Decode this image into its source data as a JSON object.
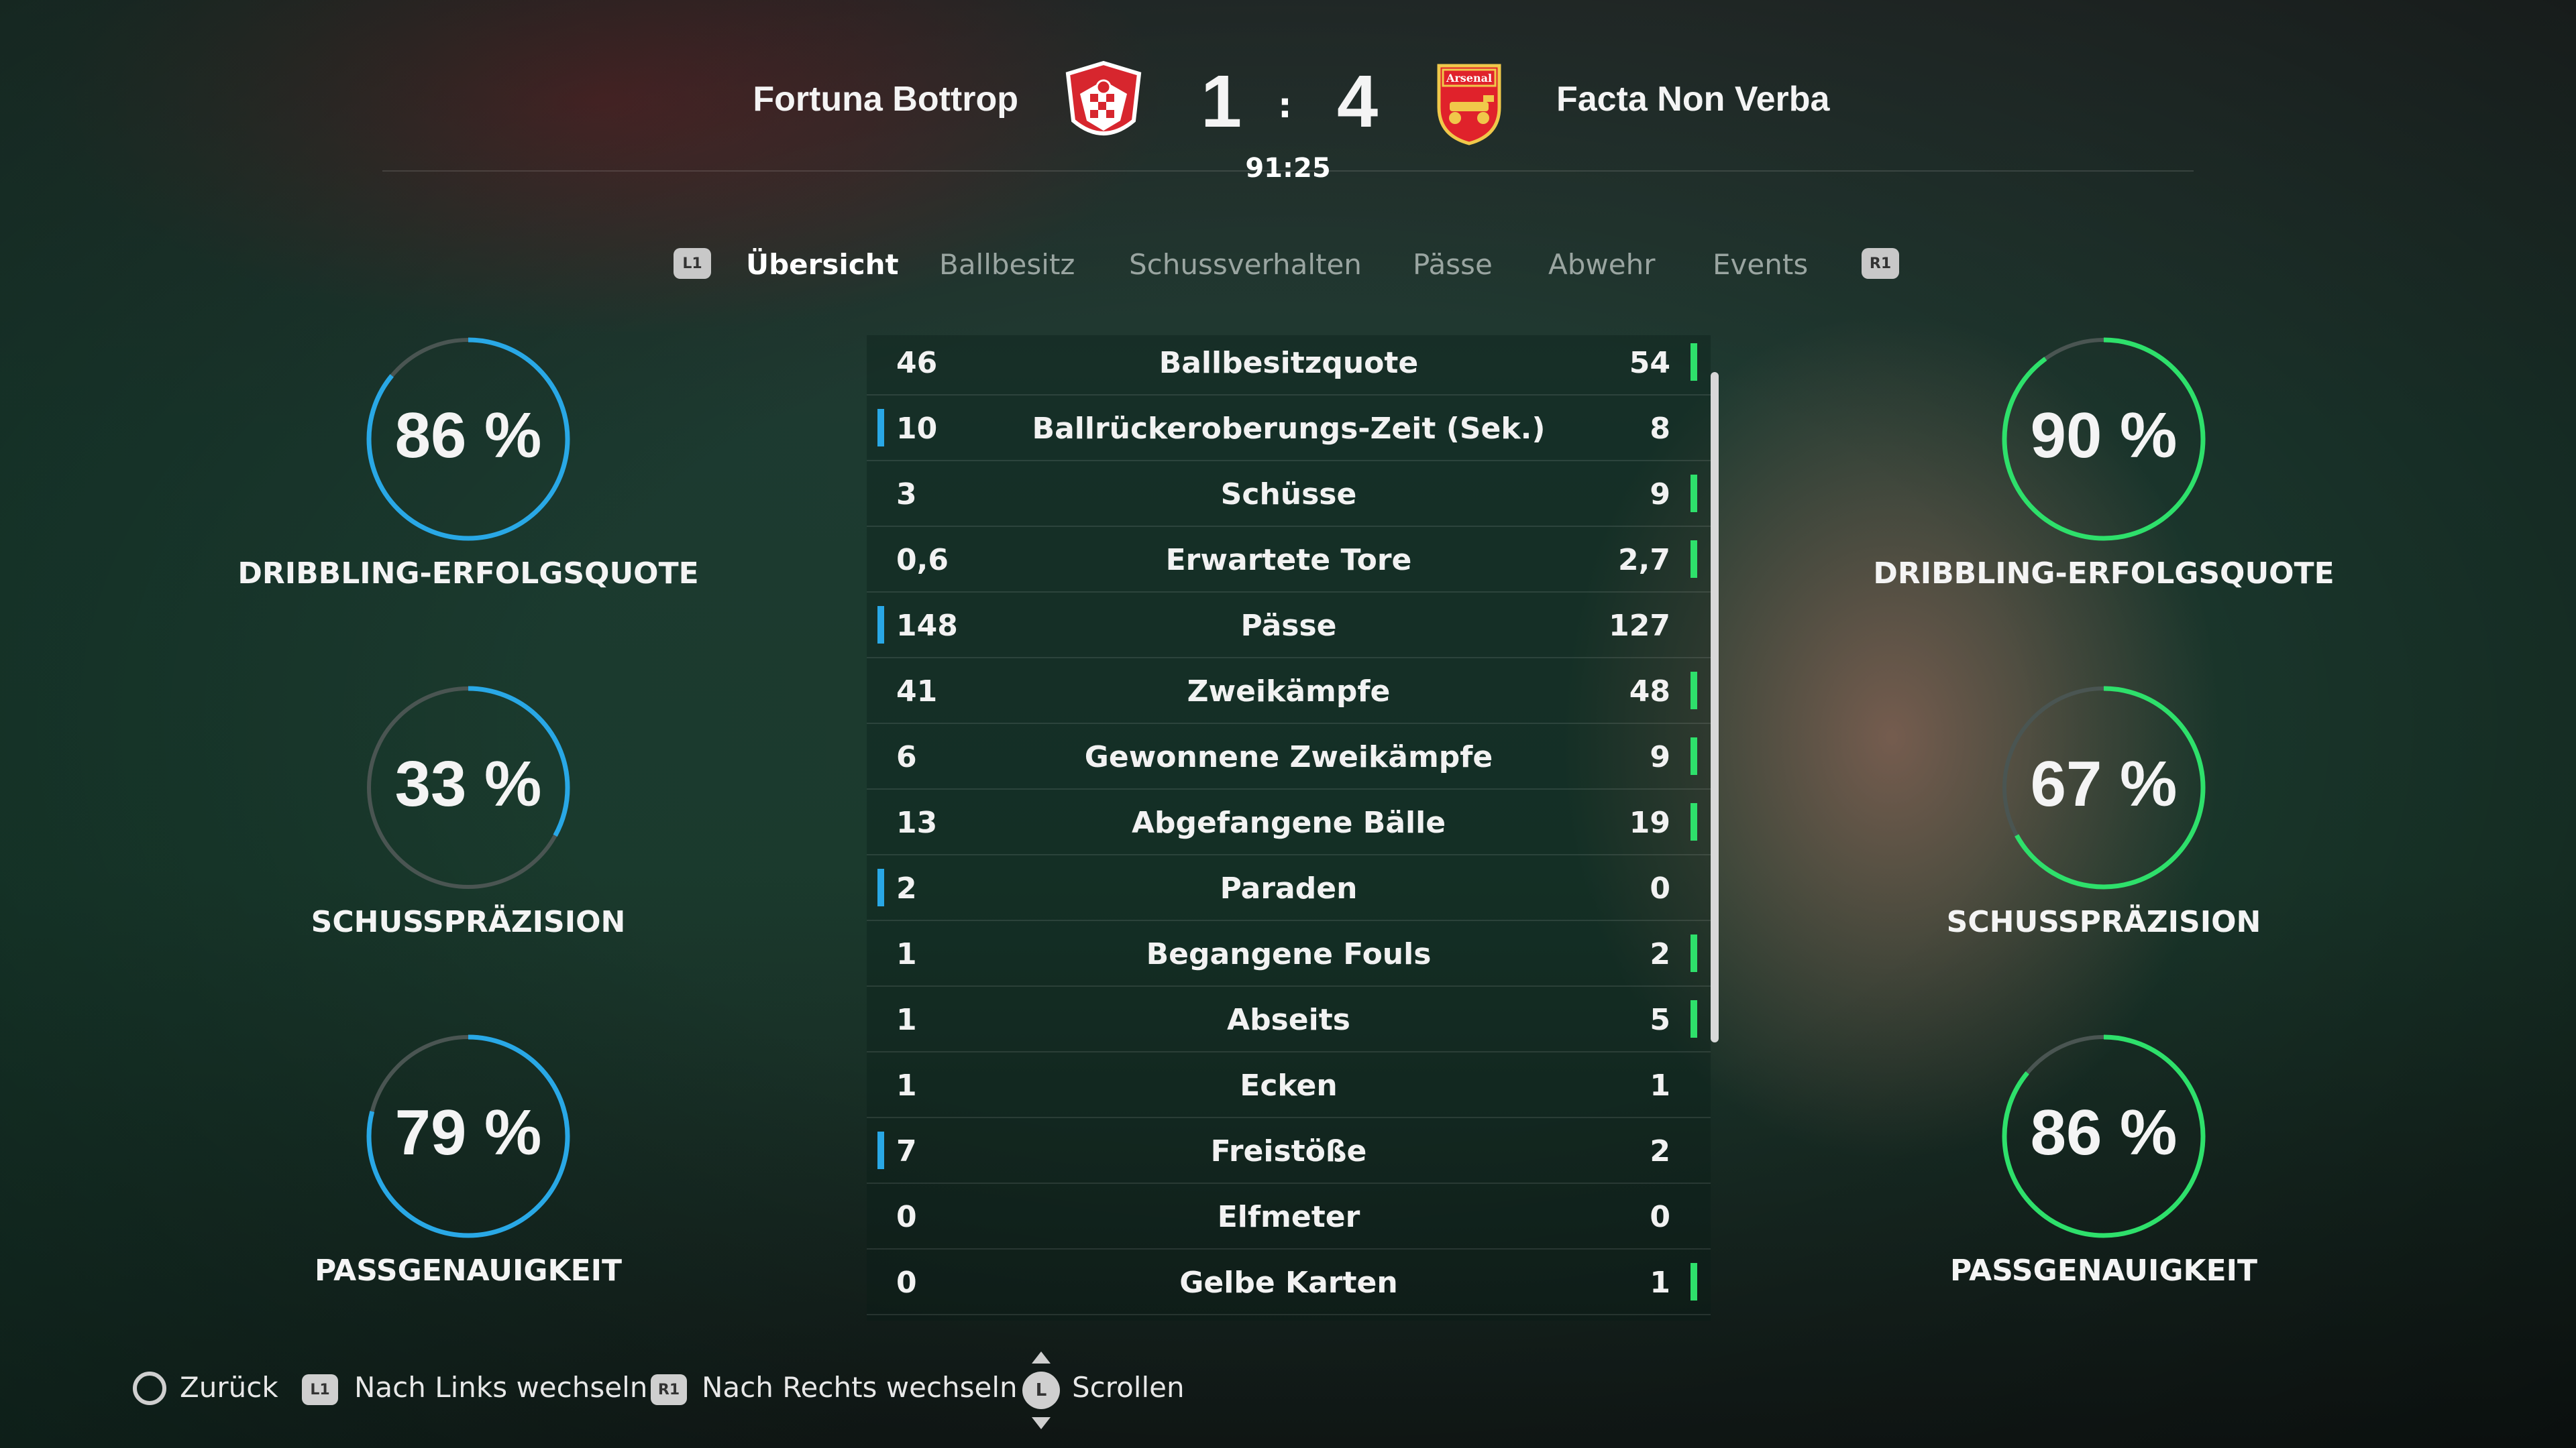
{
  "header": {
    "home_team": "Fortuna Bottrop",
    "away_team": "Facta Non Verba",
    "home_score": "1",
    "away_score": "4",
    "score_separator": ":",
    "clock": "91:25",
    "away_crest_text": "Arsenal"
  },
  "tabs": {
    "left_bumper": "L1",
    "right_bumper": "R1",
    "items": [
      "Übersicht",
      "Ballbesitz",
      "Schussverhalten",
      "Pässe",
      "Abwehr",
      "Events"
    ],
    "active": "Übersicht"
  },
  "colors": {
    "home": "#29a8e6",
    "away": "#2ee06b",
    "ring_track": "#4a5552"
  },
  "left_rings": [
    {
      "value": "86 %",
      "fraction": 0.86,
      "label": "DRIBBLING-ERFOLGSQUOTE"
    },
    {
      "value": "33 %",
      "fraction": 0.33,
      "label": "SCHUSSPRÄZISION"
    },
    {
      "value": "79 %",
      "fraction": 0.79,
      "label": "PASSGENAUIGKEIT"
    }
  ],
  "right_rings": [
    {
      "value": "90 %",
      "fraction": 0.9,
      "label": "DRIBBLING-ERFOLGSQUOTE"
    },
    {
      "value": "67 %",
      "fraction": 0.67,
      "label": "SCHUSSPRÄZISION"
    },
    {
      "value": "86 %",
      "fraction": 0.86,
      "label": "PASSGENAUIGKEIT"
    }
  ],
  "stats": [
    {
      "home": "46",
      "label": "Ballbesitzquote",
      "away": "54",
      "leader": "away"
    },
    {
      "home": "10",
      "label": "Ballrückeroberungs-Zeit (Sek.)",
      "away": "8",
      "leader": "home"
    },
    {
      "home": "3",
      "label": "Schüsse",
      "away": "9",
      "leader": "away"
    },
    {
      "home": "0,6",
      "label": "Erwartete Tore",
      "away": "2,7",
      "leader": "away"
    },
    {
      "home": "148",
      "label": "Pässe",
      "away": "127",
      "leader": "home"
    },
    {
      "home": "41",
      "label": "Zweikämpfe",
      "away": "48",
      "leader": "away"
    },
    {
      "home": "6",
      "label": "Gewonnene Zweikämpfe",
      "away": "9",
      "leader": "away"
    },
    {
      "home": "13",
      "label": "Abgefangene Bälle",
      "away": "19",
      "leader": "away"
    },
    {
      "home": "2",
      "label": "Paraden",
      "away": "0",
      "leader": "home"
    },
    {
      "home": "1",
      "label": "Begangene Fouls",
      "away": "2",
      "leader": "away"
    },
    {
      "home": "1",
      "label": "Abseits",
      "away": "5",
      "leader": "away"
    },
    {
      "home": "1",
      "label": "Ecken",
      "away": "1",
      "leader": "none"
    },
    {
      "home": "7",
      "label": "Freistöße",
      "away": "2",
      "leader": "home"
    },
    {
      "home": "0",
      "label": "Elfmeter",
      "away": "0",
      "leader": "none"
    },
    {
      "home": "0",
      "label": "Gelbe Karten",
      "away": "1",
      "leader": "away"
    }
  ],
  "footer": {
    "back_label": "Zurück",
    "l1_icon": "L1",
    "left_label": "Nach Links wechseln",
    "r1_icon": "R1",
    "right_label": "Nach Rechts wechseln",
    "stick_icon": "L",
    "scroll_label": "Scrollen"
  }
}
